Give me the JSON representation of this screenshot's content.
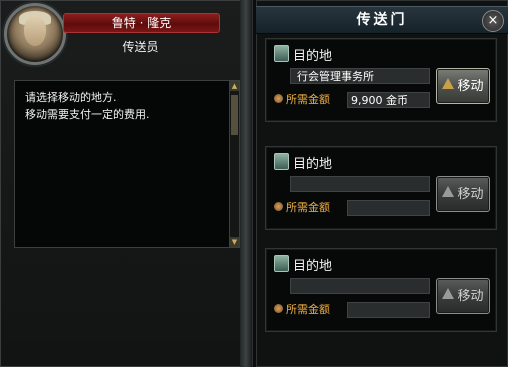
{
  "npc": {
    "name": "鲁特 · 隆克",
    "role": "传送员",
    "dialog_lines": [
      "请选择移动的地方.",
      "移动需要支付一定的费用."
    ]
  },
  "portal": {
    "title": "传送门",
    "close_label": "×",
    "destinations": [
      {
        "header": "目的地",
        "name": "行会管理事务所",
        "fee_label": "所需金额",
        "fee": "9,900 金币",
        "move_label": "移动",
        "enabled": true
      },
      {
        "header": "目的地",
        "name": "",
        "fee_label": "所需金额",
        "fee": "",
        "move_label": "移动",
        "enabled": false
      },
      {
        "header": "目的地",
        "name": "",
        "fee_label": "所需金额",
        "fee": "",
        "move_label": "移动",
        "enabled": false
      }
    ]
  },
  "icons": {
    "map": "map-icon",
    "coin": "coin-icon",
    "move": "up-arrow-icon",
    "close": "close-icon"
  },
  "colors": {
    "name_plate": "#8e1e1e",
    "fee_label": "#f0b040",
    "title_bar": "#28353d"
  }
}
